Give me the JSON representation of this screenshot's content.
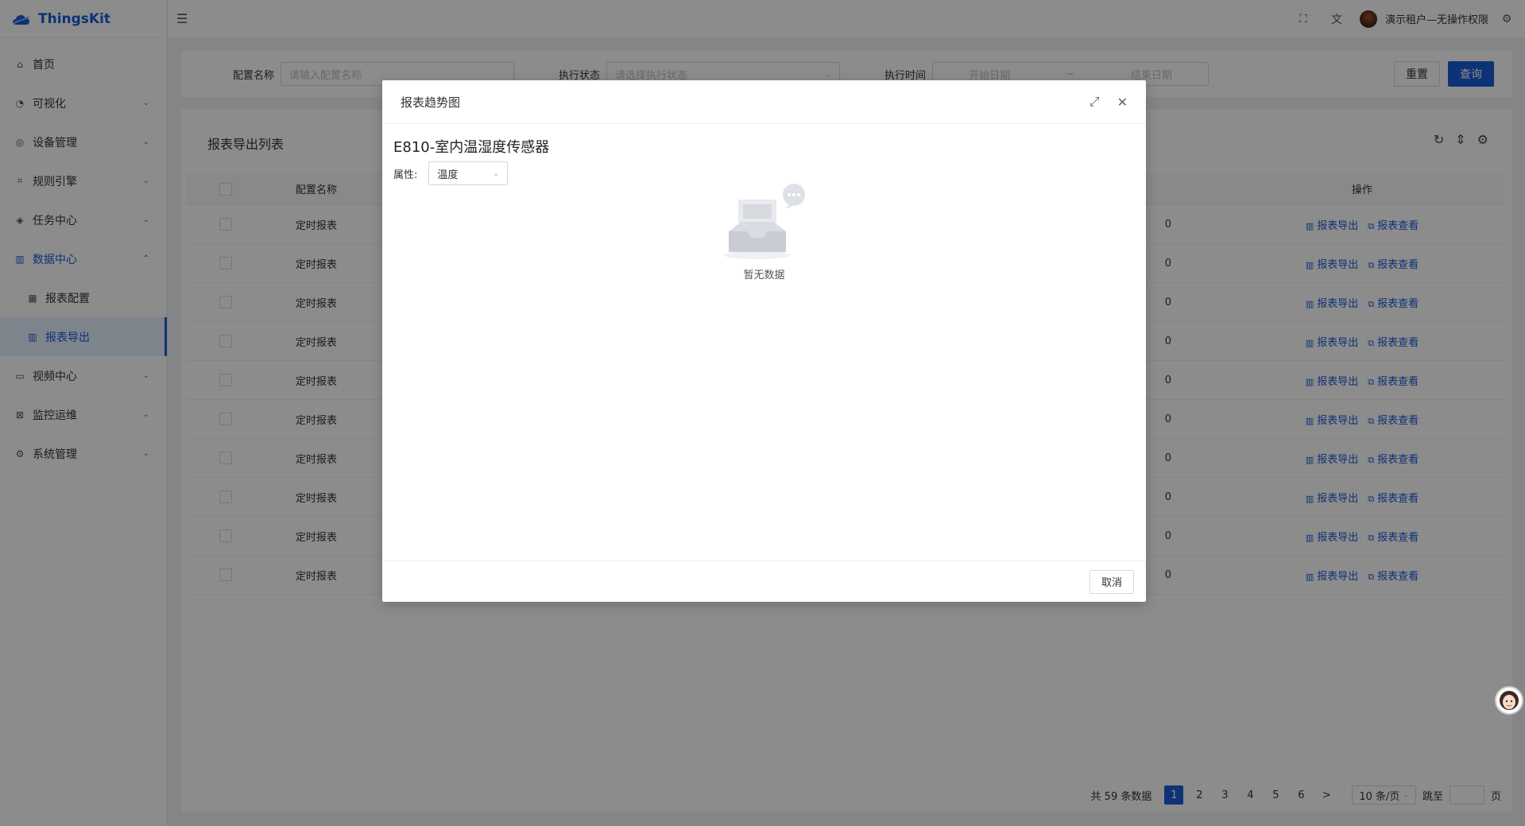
{
  "app": {
    "name": "ThingsKit"
  },
  "header": {
    "user_name": "演示租户—无操作权限"
  },
  "sidebar": {
    "items": [
      {
        "label": "首页",
        "icon": "home-icon"
      },
      {
        "label": "可视化",
        "icon": "dashboard-icon"
      },
      {
        "label": "设备管理",
        "icon": "device-icon"
      },
      {
        "label": "规则引擎",
        "icon": "rule-icon"
      },
      {
        "label": "任务中心",
        "icon": "task-icon"
      },
      {
        "label": "数据中心",
        "icon": "chart-icon"
      },
      {
        "label": "报表配置",
        "icon": "table-icon"
      },
      {
        "label": "报表导出",
        "icon": "chart-icon"
      },
      {
        "label": "视频中心",
        "icon": "video-icon"
      },
      {
        "label": "监控运维",
        "icon": "monitor-icon"
      },
      {
        "label": "系统管理",
        "icon": "gear-icon"
      }
    ]
  },
  "search": {
    "config_name_label": "配置名称",
    "config_name_placeholder": "请输入配置名称",
    "status_label": "执行状态",
    "status_placeholder": "请选择执行状态",
    "time_label": "执行时间",
    "start_placeholder": "开始日期",
    "range_sep": "~",
    "end_placeholder": "结束日期",
    "reset_label": "重置",
    "query_label": "查询"
  },
  "table": {
    "title": "报表导出列表",
    "col_name": "配置名称",
    "col_op": "操作",
    "partial_cell": "0",
    "export_label": "报表导出",
    "view_label": "报表查看",
    "rows": [
      "定时报表",
      "定时报表",
      "定时报表",
      "定时报表",
      "定时报表",
      "定时报表",
      "定时报表",
      "定时报表",
      "定时报表",
      "定时报表"
    ]
  },
  "pagination": {
    "total": "共 59 条数据",
    "pages": [
      "1",
      "2",
      "3",
      "4",
      "5",
      "6"
    ],
    "next": ">",
    "page_size": "10 条/页",
    "jump_label": "跳至",
    "page_suffix": "页"
  },
  "modal": {
    "title": "报表趋势图",
    "device_title": "E810-室内温湿度传感器",
    "prop_label": "属性:",
    "prop_value": "温度",
    "empty_text": "暂无数据",
    "cancel_label": "取消"
  }
}
